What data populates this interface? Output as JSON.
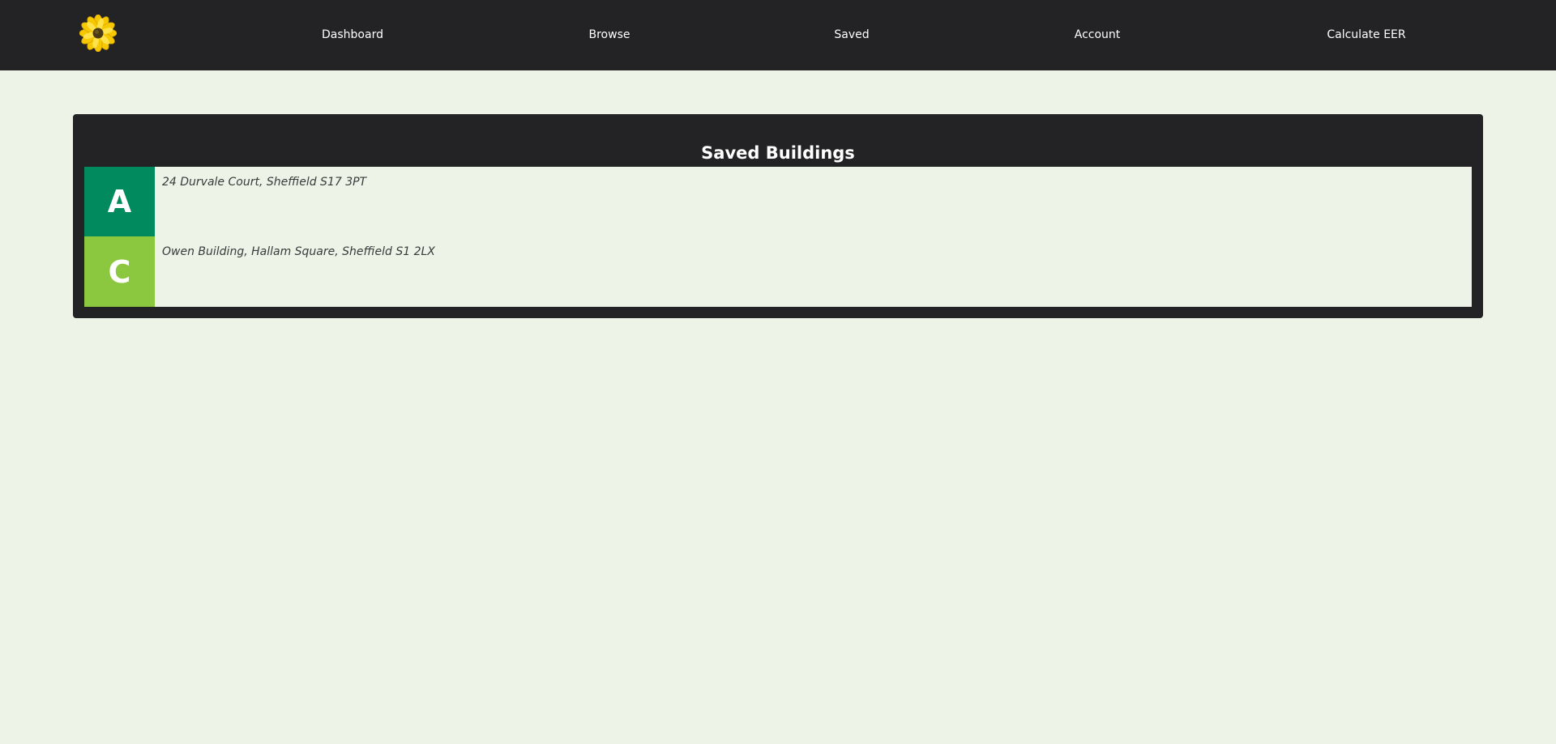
{
  "nav": {
    "logo_icon": "sunflower-icon",
    "links": [
      {
        "label": "Dashboard"
      },
      {
        "label": "Browse"
      },
      {
        "label": "Saved"
      },
      {
        "label": "Account"
      },
      {
        "label": "Calculate EER"
      }
    ]
  },
  "saved": {
    "title": "Saved Buildings",
    "buildings": [
      {
        "rating": "A",
        "rating_color": "#008a5e",
        "address": "24 Durvale Court, Sheffield S17 3PT"
      },
      {
        "rating": "C",
        "rating_color": "#8cc83f",
        "address": "Owen Building, Hallam Square, Sheffield S1 2LX"
      }
    ]
  },
  "colors": {
    "navbar_bg": "#232325",
    "page_bg": "#edf3e7",
    "panel_bg": "#232325"
  }
}
